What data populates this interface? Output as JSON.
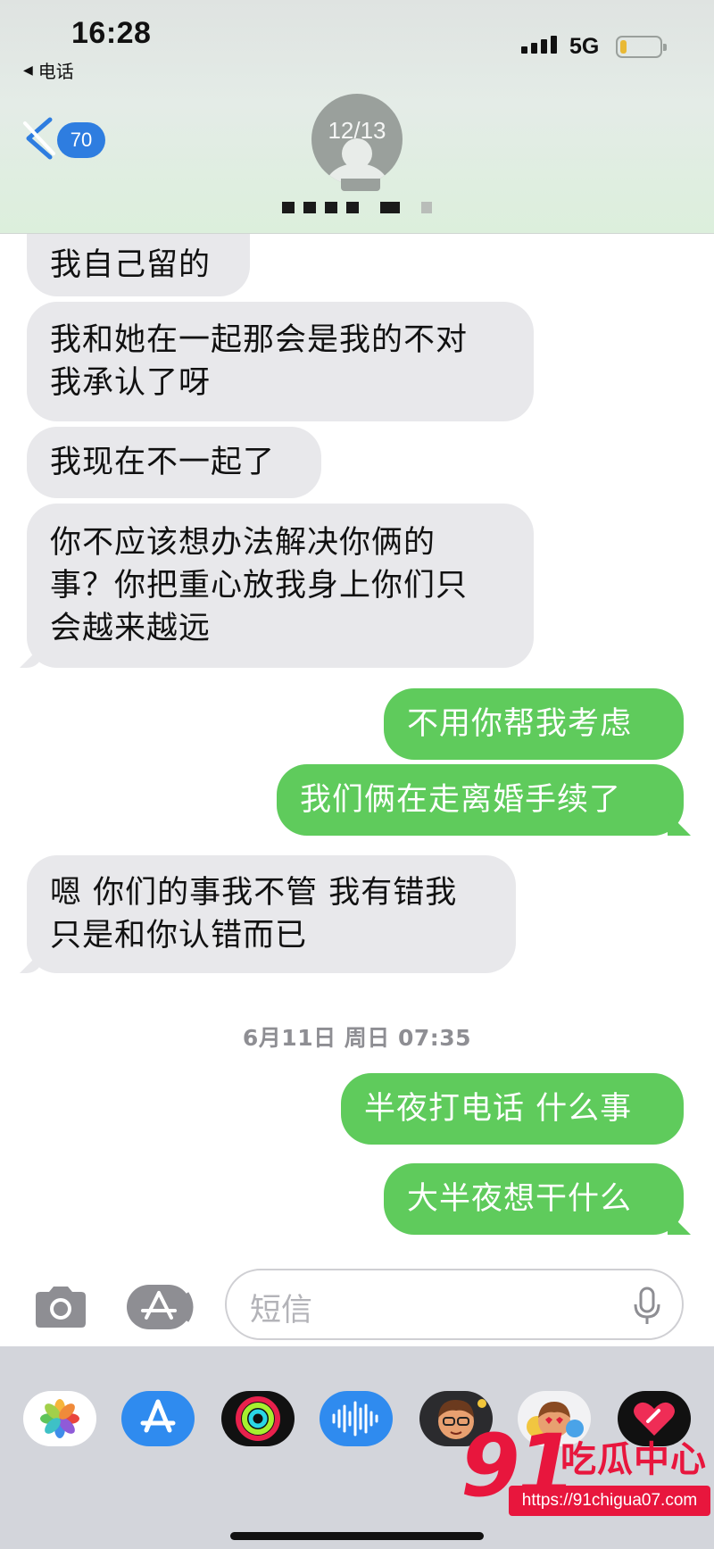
{
  "status_bar": {
    "time": "16:28",
    "back_app": "电话",
    "network": "5G",
    "battery_level": 0.15
  },
  "header": {
    "unread_count": "70",
    "avatar_text": "12/13",
    "contact_name_hidden": true
  },
  "messages": [
    {
      "dir": "in",
      "lines": [
        "我自己留的"
      ]
    },
    {
      "dir": "in",
      "lines": [
        "我和她在一起那会是我的不对",
        "我承认了呀"
      ]
    },
    {
      "dir": "in",
      "lines": [
        "我现在不一起了"
      ]
    },
    {
      "dir": "in",
      "lines": [
        "你不应该想办法解决你俩的",
        "事？你把重心放我身上你们只",
        "会越来越远"
      ]
    },
    {
      "dir": "out",
      "lines": [
        "不用你帮我考虑"
      ]
    },
    {
      "dir": "out",
      "lines": [
        "我们俩在走离婚手续了"
      ]
    },
    {
      "dir": "in",
      "lines": [
        "嗯 你们的事我不管 我有错我",
        "只是和你认错而已"
      ]
    },
    {
      "dir": "out",
      "lines": [
        "半夜打电话 什么事"
      ]
    },
    {
      "dir": "out",
      "lines": [
        "大半夜想干什么"
      ]
    }
  ],
  "timestamp": "6月11日 周日 07:35",
  "input": {
    "placeholder": "短信"
  },
  "app_drawer": [
    {
      "icon": "photos-icon"
    },
    {
      "icon": "app-store-icon"
    },
    {
      "icon": "activity-rings-icon"
    },
    {
      "icon": "audio-message-icon"
    },
    {
      "icon": "memoji-icon"
    },
    {
      "icon": "memoji-stickers-icon"
    },
    {
      "icon": "digital-touch-icon"
    }
  ],
  "watermark": {
    "logo_number": "91",
    "logo_text": "吃瓜中心",
    "url": "https://91chigua07.com"
  },
  "colors": {
    "incoming_bubble": "#e8e8eb",
    "outgoing_bubble": "#5fcb5c",
    "badge": "#2e7de0",
    "watermark": "#e8163d"
  }
}
